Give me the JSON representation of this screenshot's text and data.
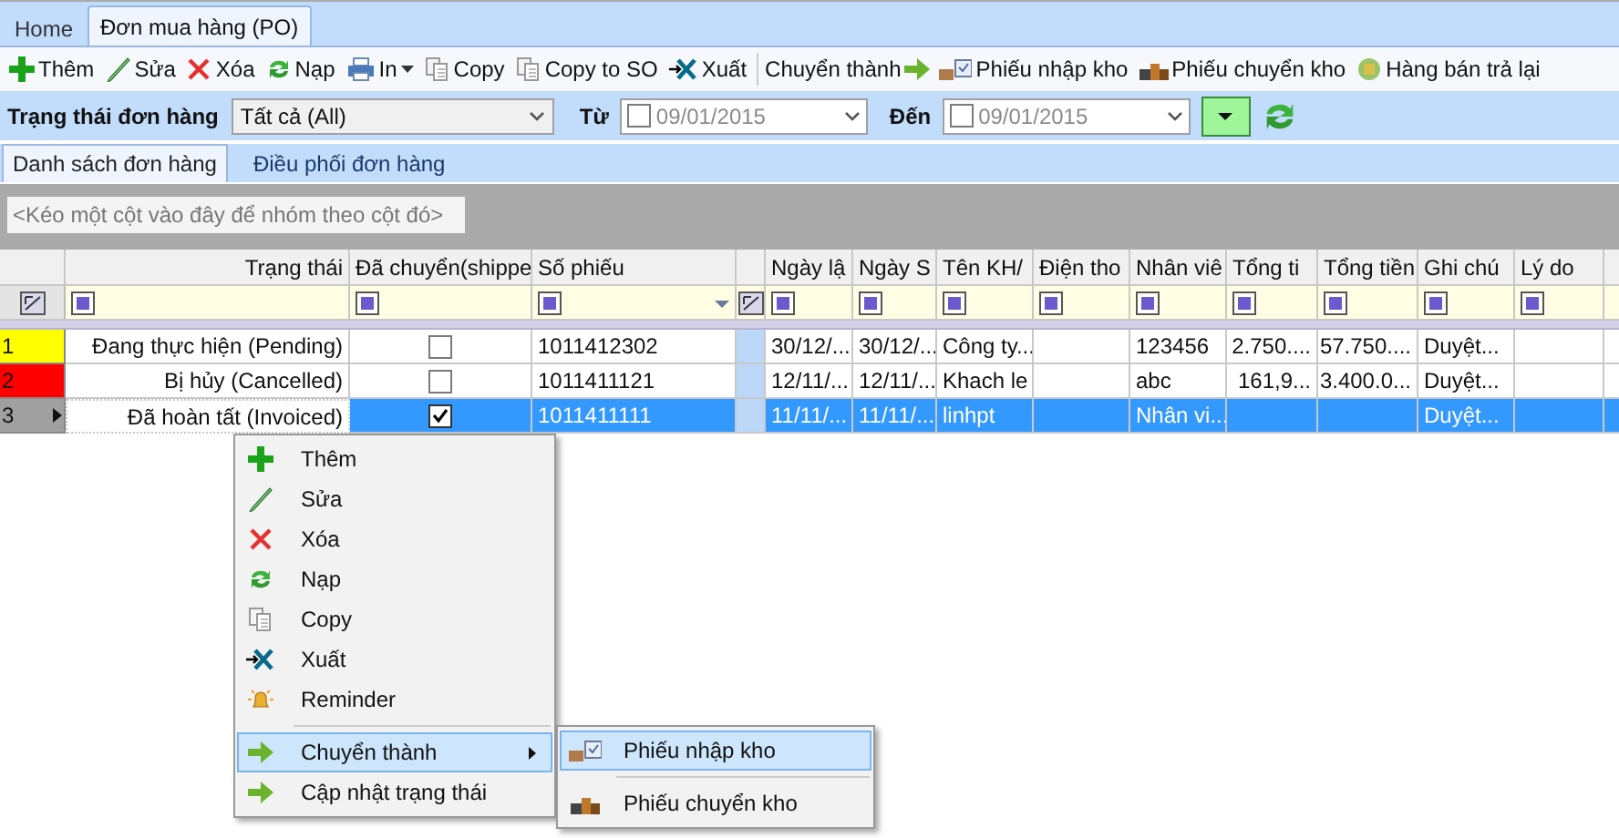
{
  "top_tabs": [
    {
      "label": "Home",
      "selected": false
    },
    {
      "label": "Đơn mua hàng (PO)",
      "selected": true
    }
  ],
  "toolbar": [
    {
      "kind": "button",
      "label": "Thêm"
    },
    {
      "kind": "button",
      "label": "Sửa"
    },
    {
      "kind": "button",
      "label": "Xóa"
    },
    {
      "kind": "button",
      "label": "Nạp"
    },
    {
      "kind": "dropdown",
      "label": "In"
    },
    {
      "kind": "button",
      "label": "Copy"
    },
    {
      "kind": "button",
      "label": "Copy to SO"
    },
    {
      "kind": "button",
      "label": "Xuất"
    },
    {
      "kind": "label",
      "label": "Chuyển thành"
    },
    {
      "kind": "button",
      "label": "Phiếu nhập kho"
    },
    {
      "kind": "button",
      "label": "Phiếu chuyển kho"
    },
    {
      "kind": "button",
      "label": "Hàng bán trả lại"
    }
  ],
  "filter": {
    "status_label": "Trạng thái đơn hàng",
    "status_value": "Tất cả (All)",
    "from_label": "Từ",
    "from": {
      "checked": false,
      "value": "09/01/2015"
    },
    "to_label": "Đến",
    "to": {
      "checked": false,
      "value": "09/01/2015"
    }
  },
  "sub_tabs": [
    {
      "label": "Danh sách đơn hàng",
      "selected": true
    },
    {
      "label": "Điều phối đơn hàng",
      "selected": false
    }
  ],
  "group_hint": "<Kéo một cột vào đây để nhóm theo cột đó>",
  "table": {
    "columns": [
      "Trạng thái",
      "Đã chuyển(shippe",
      "Số phiếu",
      "Ngày lậ",
      "Ngày S",
      "Tên KH/",
      "Điện tho",
      "Nhân viê",
      "Tổng ti",
      "Tổng tiền",
      "Ghi chú",
      "Lý do"
    ],
    "rows": [
      {
        "number": "1",
        "color": "#ffff00",
        "selected": false,
        "cells": [
          "Đang thực hiện (Pending)",
          {
            "checked": false
          },
          "1011412302",
          "30/12/...",
          "30/12/...",
          "Công ty...",
          "",
          "123456",
          "2.750....",
          "57.750....",
          "Duyệt...",
          ""
        ]
      },
      {
        "number": "2",
        "color": "#ff0000",
        "selected": false,
        "cells": [
          "Bị hủy (Cancelled)",
          {
            "checked": false
          },
          "1011411121",
          "12/11/...",
          "12/11/...",
          "Khach le",
          "",
          "abc",
          "161,9...",
          "3.400.0...",
          "Duyệt...",
          ""
        ]
      },
      {
        "number": "3",
        "color": "#a0a0a0",
        "selected": true,
        "cells": [
          "Đã hoàn tất (Invoiced)",
          {
            "checked": true
          },
          "1011411111",
          "11/11/...",
          "11/11/...",
          "linhpt",
          "",
          "Nhân vi...",
          "",
          "",
          "Duyệt...",
          ""
        ]
      }
    ]
  },
  "context_menu": [
    {
      "label": "Thêm",
      "selected": false,
      "submenu": false
    },
    {
      "label": "Sửa",
      "selected": false,
      "submenu": false
    },
    {
      "label": "Xóa",
      "selected": false,
      "submenu": false
    },
    {
      "label": "Nạp",
      "selected": false,
      "submenu": false
    },
    {
      "label": "Copy",
      "selected": false,
      "submenu": false
    },
    {
      "label": "Xuất",
      "selected": false,
      "submenu": false
    },
    {
      "label": "Reminder",
      "selected": false,
      "submenu": false
    },
    {
      "label": "Chuyển thành",
      "selected": true,
      "submenu": true
    },
    {
      "label": "Cập nhật trạng thái",
      "selected": false,
      "submenu": false
    }
  ],
  "submenu": [
    {
      "label": "Phiếu nhập kho",
      "selected": true
    },
    {
      "label": "Phiếu chuyển kho",
      "selected": false
    }
  ]
}
